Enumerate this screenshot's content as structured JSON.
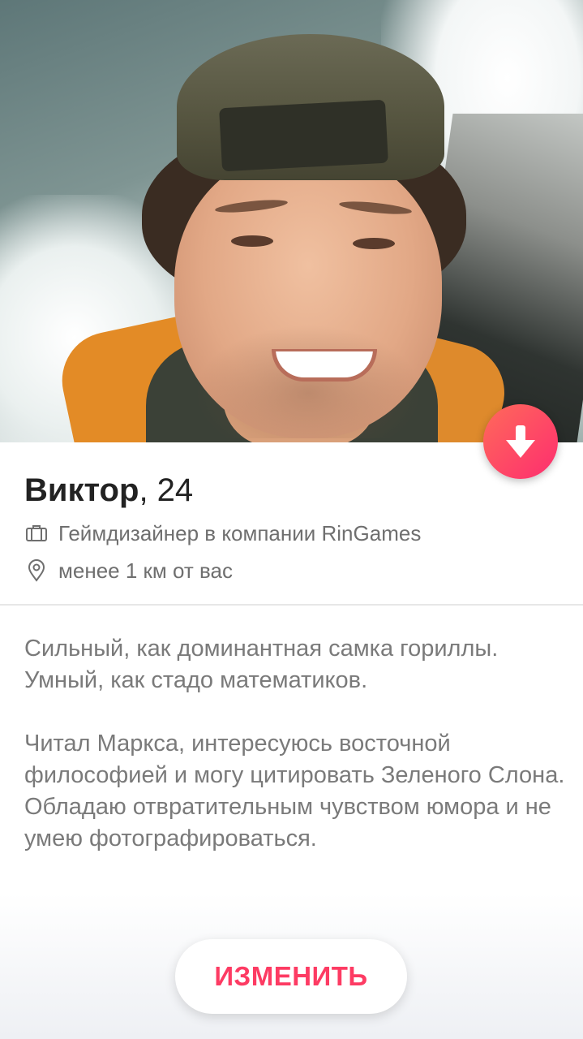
{
  "profile": {
    "name": "Виктор",
    "age_text": ", 24",
    "job": "Геймдизайнер в компании RinGames",
    "distance": "менее 1 км от вас",
    "bio": [
      "Сильный, как доминантная самка гориллы. Умный, как стадо математиков.",
      "Читал Маркса, интересуюсь восточной философией и могу цитировать Зеленого Слона. Обладаю отвратительным чувством юмора и не умею фотографироваться."
    ]
  },
  "actions": {
    "edit_label": "ИЗМЕНИТЬ",
    "collapse_icon": "arrow-down-icon"
  },
  "colors": {
    "accent": "#fd3b63",
    "fab_gradient_start": "#ff6a5a",
    "fab_gradient_end": "#fd2d6f"
  }
}
